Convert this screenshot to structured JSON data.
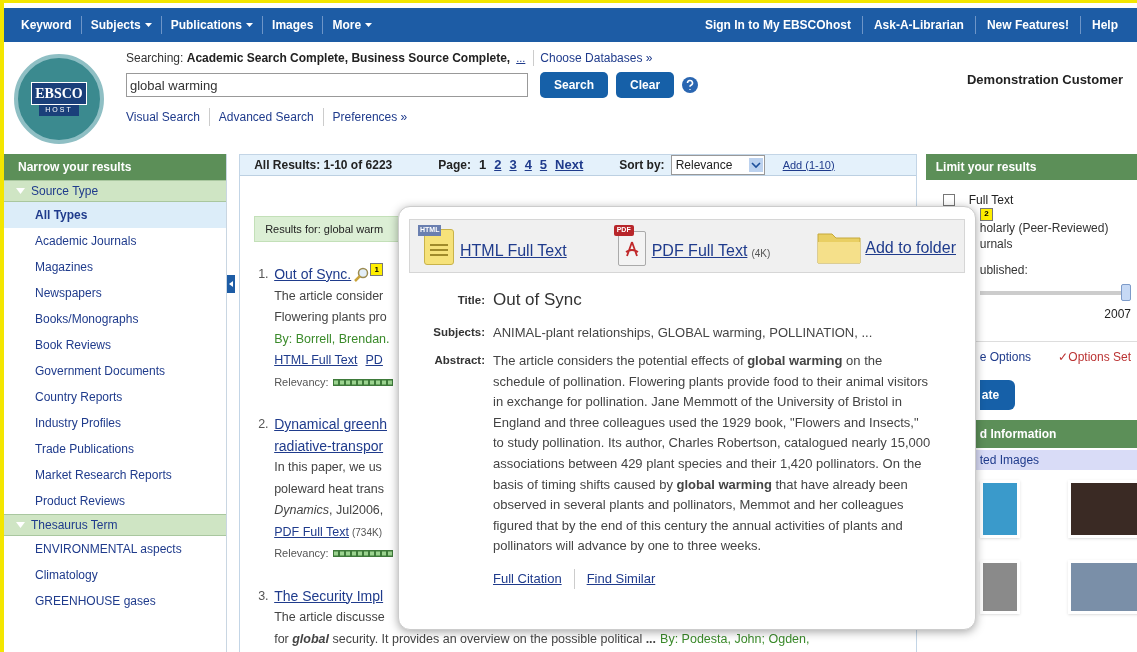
{
  "top_nav": {
    "left": [
      {
        "label": "Keyword",
        "dropdown": false
      },
      {
        "label": "Subjects",
        "dropdown": true
      },
      {
        "label": "Publications",
        "dropdown": true
      },
      {
        "label": "Images",
        "dropdown": false
      },
      {
        "label": "More",
        "dropdown": true
      }
    ],
    "right": [
      "Sign In to My EBSCOhost",
      "Ask-A-Librarian",
      "New Features!",
      "Help"
    ]
  },
  "header": {
    "logo": "EBSCO",
    "logo_sub": "HOST",
    "searching_label": "Searching:",
    "databases": "Academic Search Complete, Business Source Complete,",
    "more": "...",
    "choose": "Choose Databases »",
    "search_value": "global warming",
    "buttons": [
      "Search",
      "Clear"
    ],
    "user": "Demonstration Customer",
    "links": [
      "Visual Search",
      "Advanced Search",
      "Preferences »"
    ]
  },
  "narrow": {
    "title": "Narrow your results",
    "sections": [
      {
        "title": "Source Type",
        "expanded": true,
        "items": [
          {
            "label": "All Types",
            "selected": true
          },
          {
            "label": "Academic Journals",
            "selected": false
          },
          {
            "label": "Magazines",
            "selected": false
          },
          {
            "label": "Newspapers",
            "selected": false
          },
          {
            "label": "Books/Monographs",
            "selected": false
          },
          {
            "label": "Book Reviews",
            "selected": false
          },
          {
            "label": "Government Documents",
            "selected": false
          },
          {
            "label": "Country Reports",
            "selected": false
          },
          {
            "label": "Industry Profiles",
            "selected": false
          },
          {
            "label": "Trade Publications",
            "selected": false
          },
          {
            "label": "Market Research Reports",
            "selected": false
          },
          {
            "label": "Product Reviews",
            "selected": false
          }
        ]
      },
      {
        "title": "Thesaurus Term",
        "expanded": true,
        "items": [
          {
            "label": "ENVIRONMENTAL aspects",
            "selected": false
          },
          {
            "label": "Climatology",
            "selected": false
          },
          {
            "label": "GREENHOUSE gases",
            "selected": false
          }
        ]
      }
    ]
  },
  "results": {
    "summary": "All Results: 1-10 of 6223",
    "page_label": "Page:",
    "pages": [
      {
        "label": "1",
        "selected": true
      },
      {
        "label": "2",
        "selected": false
      },
      {
        "label": "3",
        "selected": false
      },
      {
        "label": "4",
        "selected": false
      },
      {
        "label": "5",
        "selected": false
      }
    ],
    "next": "Next",
    "sort_label": "Sort by:",
    "sort": "Relevance",
    "add": "Add (1-10)",
    "results_for": "Results for: global warm",
    "items": [
      {
        "number": "1.",
        "title": [
          "Out of Sync."
        ],
        "preview": true,
        "badge": "1",
        "lines": [
          {
            "kind": "text",
            "text": "The article consider"
          },
          {
            "kind": "text",
            "text": "Flowering plants pro"
          },
          {
            "kind": "author",
            "text": "By: Borrell, Brendan."
          },
          {
            "kind": "links",
            "links": [
              {
                "label": "HTML Full Text"
              },
              {
                "label": "PD"
              }
            ]
          },
          {
            "kind": "relevancy",
            "text": "Relevancy:"
          }
        ]
      },
      {
        "number": "2.",
        "title": [
          "Dynamical greenh",
          "radiative-transpor"
        ],
        "preview": false,
        "lines": [
          {
            "kind": "text",
            "text": "In this paper, we us"
          },
          {
            "kind": "text",
            "text": "poleward heat trans"
          },
          {
            "kind": "text",
            "text": "*Dynamics*, Jul2006,"
          },
          {
            "kind": "links",
            "links": [
              {
                "label": "PDF Full Text",
                "size": "(734K)"
              }
            ]
          },
          {
            "kind": "relevancy",
            "text": "Relevancy:"
          }
        ]
      },
      {
        "number": "3.",
        "title": [
          "The Security Impl"
        ],
        "preview": false,
        "lines": [
          {
            "kind": "text",
            "text": "The article discusse"
          },
          {
            "kind": "mixed",
            "text": "for **global** security. It provides an overview on the possible political **...**",
            "author": "By: Podesta, John; Ogden,"
          }
        ]
      }
    ]
  },
  "preview": {
    "actions": [
      {
        "kind": "html",
        "icon_text": "HTML",
        "label": "HTML Full Text"
      },
      {
        "kind": "pdf",
        "icon_text": "PDF",
        "label": "PDF Full Text",
        "size": "(4K)"
      },
      {
        "kind": "folder",
        "label": "Add to folder"
      }
    ],
    "fields": [
      {
        "kind": "title",
        "label": "Title:",
        "value": "Out of Sync"
      },
      {
        "kind": "plain",
        "label": "Subjects:",
        "value": "ANIMAL-plant relationships, GLOBAL warming, POLLINATION, ..."
      },
      {
        "kind": "plain",
        "label": "Abstract:",
        "value": "The article considers the potential effects of **global warming** on the schedule of pollination. Flowering plants provide food to their animal visitors in exchange for pollination. Jane Memmott of the University of Bristol in England and three colleagues used the 1929 book, \"Flowers and Insects,\" to study pollination. Its author, Charles Robertson, catalogued nearly 15,000 associations between 429 plant species and their 1,420 pollinators. On the basis of timing shifts caused by **global warming** that have already been observed in several plants and pollinators, Memmot and her colleagues figured that by the end of this century the annual activities of plants and pollinators will advance by one to three weeks."
      }
    ],
    "links": [
      "Full Citation",
      "Find Similar"
    ]
  },
  "limit": {
    "title": "Limit your results",
    "full_text": {
      "label": "Full Text",
      "checked": false
    },
    "badge": "2",
    "scholarly": [
      "holarly (Peer-Reviewed)",
      "urnals"
    ],
    "published": "ublished:",
    "slider": {
      "level": 1
    },
    "year": "2007",
    "options": "e Options",
    "options_set": "✓Options Set",
    "update": "ate",
    "related": "d Information",
    "images_header": "ted Images"
  }
}
